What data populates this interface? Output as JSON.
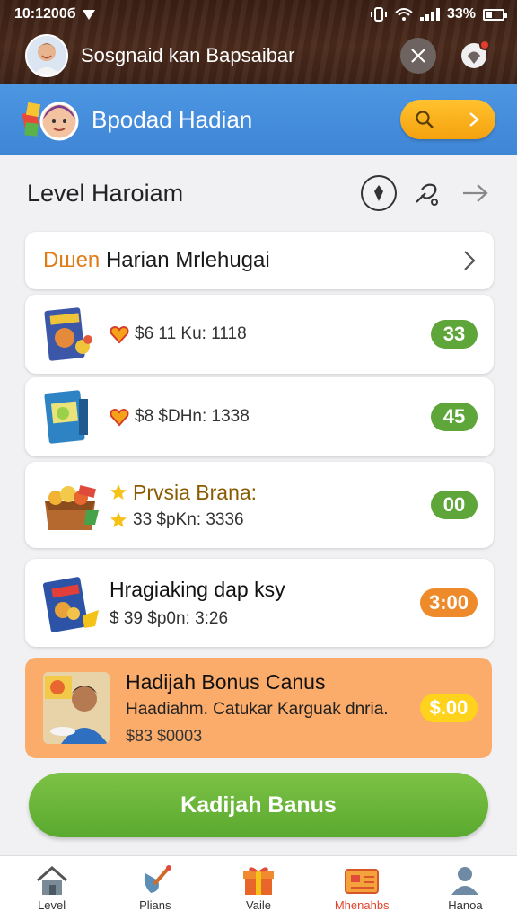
{
  "status_bar": {
    "time": "10:1200б",
    "battery": "33%"
  },
  "header": {
    "profile_name": "Sosgnaid kan Bapsaibar"
  },
  "banner": {
    "title": "Bpodad Hadian"
  },
  "level": {
    "title": "Level Haroiam"
  },
  "section": {
    "title_prefix": "Dшen",
    "title_rest": " Harian Mrlehugai"
  },
  "items": [
    {
      "price_line": "$6 11 Ku: 1118",
      "badge": "33",
      "badge_color": "#5ea639"
    },
    {
      "price_line": "$8 $DHn: 1338",
      "badge": "45",
      "badge_color": "#5ea639"
    },
    {
      "name": "Prvsia Brana:",
      "price_line": "33 $pKn: 3336",
      "badge": "00",
      "badge_color": "#5ea639"
    },
    {
      "name": "Hragiaking dap ksy",
      "price_line": "$ 39 $p0n: 3:26",
      "badge": "3:00",
      "badge_color": "#ef8a2b"
    }
  ],
  "bonus": {
    "title": "Hadijah Bonus Canus",
    "subtitle": "Haadiahm. Catukar Karguak dnria.",
    "price": "$83 $0003",
    "badge": "$.00"
  },
  "cta_label": "Kadijah Banus",
  "nav": [
    {
      "label": "Level",
      "icon": "house-icon"
    },
    {
      "label": "Plians",
      "icon": "shovel-icon"
    },
    {
      "label": "Vaile",
      "icon": "gift-icon"
    },
    {
      "label": "Mhenahbs",
      "icon": "message-icon",
      "active": true
    },
    {
      "label": "Hanoa",
      "icon": "person-icon"
    }
  ],
  "colors": {
    "accent_green": "#5ea639",
    "banner_blue": "#4c96e2",
    "bonus_orange": "#fbab6a",
    "active_nav": "#e0462f"
  }
}
